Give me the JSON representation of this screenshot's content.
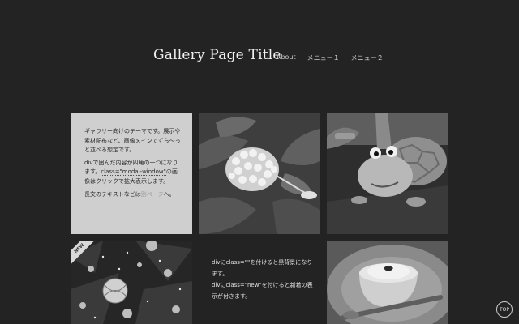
{
  "header": {
    "title": "Gallery Page Title",
    "nav": [
      {
        "label": "About"
      },
      {
        "label": "メニュー１"
      },
      {
        "label": "メニュー２"
      }
    ]
  },
  "tiles": {
    "intro": {
      "line1": "ギャラリー向けのテーマです。展示や素材配布など、画像メインでずら〜っと並べる想定です。",
      "line2_pre": "divで囲んだ内容が四角の一つになります。",
      "line2_code": "class=\"modal-window\"",
      "line2_post": "の画像はクリックで拡大表示します。",
      "line3_pre": "長文のテキストなどは",
      "line3_link": "別ページ",
      "line3_post": "へ。"
    },
    "flower": {
      "icon": "hydrangea-photo"
    },
    "turtle": {
      "icon": "turtle-photo"
    },
    "tree": {
      "badge": "NEW",
      "icon": "christmas-tree-photo"
    },
    "note": {
      "p1_pre": "divに",
      "p1_code": "class=\"\"",
      "p1_post": "を付けると黒背景になります。",
      "p2": "divにclass=\"new\"を付けると新着の表示が付きます。"
    },
    "dessert": {
      "icon": "dessert-photo"
    }
  },
  "top_button": {
    "label": "TOP"
  }
}
